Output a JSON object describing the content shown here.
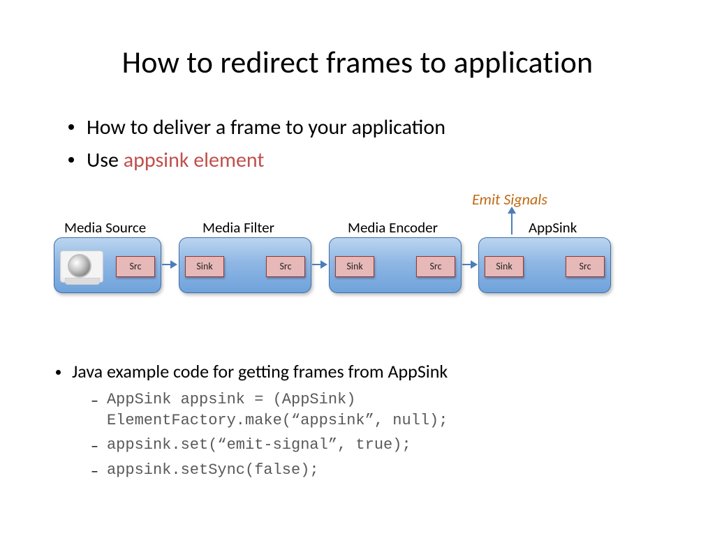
{
  "title": "How to redirect frames to application",
  "bullets_top": {
    "b0": "How to deliver a frame to your application",
    "b1_prefix": "Use ",
    "b1_accent": "appsink element"
  },
  "emit_label": "Emit Signals",
  "pipeline": {
    "labels": {
      "l0": "Media Source",
      "l1": "Media Filter",
      "l2": "Media Encoder",
      "l3": "AppSink"
    },
    "pad_src": "Src",
    "pad_sink": "Sink"
  },
  "bullets_bottom": {
    "heading": "Java example code for getting frames from AppSink",
    "code": {
      "c0": "AppSink appsink = (AppSink)\nElementFactory.make(“appsink”, null);",
      "c1": "appsink.set(“emit-signal”, true);",
      "c2": "appsink.setSync(false);"
    }
  }
}
